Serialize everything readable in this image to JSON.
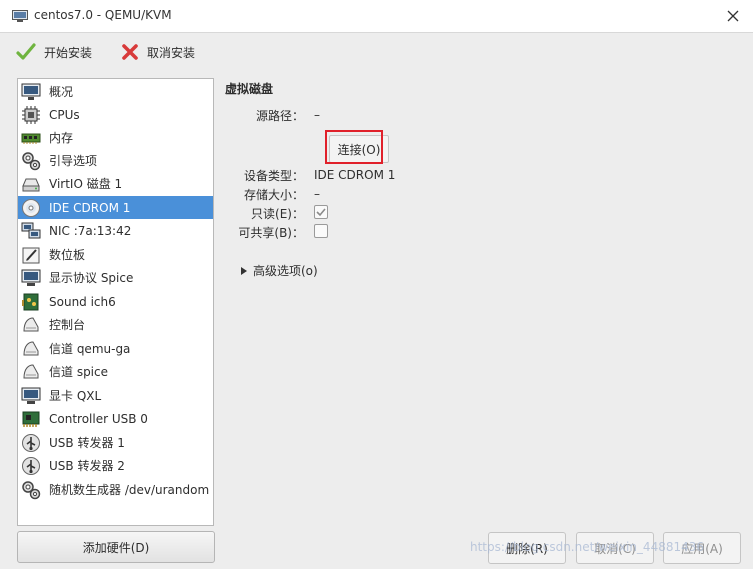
{
  "window": {
    "title": "centos7.0 - QEMU/KVM"
  },
  "toolbar": {
    "begin_install": "开始安装",
    "cancel_install": "取消安装"
  },
  "sidebar": {
    "items": [
      {
        "label": "概况",
        "icon": "overview-icon"
      },
      {
        "label": "CPUs",
        "icon": "cpu-icon"
      },
      {
        "label": "内存",
        "icon": "memory-icon"
      },
      {
        "label": "引导选项",
        "icon": "boot-options-icon"
      },
      {
        "label": "VirtIO 磁盘 1",
        "icon": "disk-icon"
      },
      {
        "label": "IDE CDROM 1",
        "icon": "cdrom-icon",
        "selected": true
      },
      {
        "label": "NIC :7a:13:42",
        "icon": "network-icon"
      },
      {
        "label": "数位板",
        "icon": "tablet-icon"
      },
      {
        "label": "显示协议 Spice",
        "icon": "display-icon"
      },
      {
        "label": "Sound ich6",
        "icon": "sound-card-icon"
      },
      {
        "label": "控制台",
        "icon": "console-icon"
      },
      {
        "label": "信道 qemu-ga",
        "icon": "channel-icon"
      },
      {
        "label": "信道 spice",
        "icon": "channel-icon"
      },
      {
        "label": "显卡 QXL",
        "icon": "video-card-icon"
      },
      {
        "label": "Controller USB 0",
        "icon": "usb-controller-icon"
      },
      {
        "label": "USB 转发器 1",
        "icon": "usb-redirector-icon"
      },
      {
        "label": "USB 转发器 2",
        "icon": "usb-redirector-icon"
      },
      {
        "label": "随机数生成器 /dev/urandom",
        "icon": "rng-icon"
      }
    ],
    "add_hardware": "添加硬件(D)"
  },
  "detail": {
    "section_title": "虚拟磁盘",
    "source_path_label": "源路径：",
    "source_path_value": "–",
    "connect_button": "连接(O)",
    "device_type_label": "设备类型：",
    "device_type_value": "IDE CDROM 1",
    "storage_size_label": "存储大小：",
    "storage_size_value": "–",
    "readonly_label": "只读(E)：",
    "readonly_checked": true,
    "shareable_label": "可共享(B)：",
    "shareable_checked": false,
    "advanced_options": "高级选项(o)"
  },
  "footer": {
    "remove": "删除(R)",
    "cancel": "取消(C)",
    "apply": "应用(A)"
  },
  "watermark": "https://blog.csdn.net/weixin_44881436"
}
